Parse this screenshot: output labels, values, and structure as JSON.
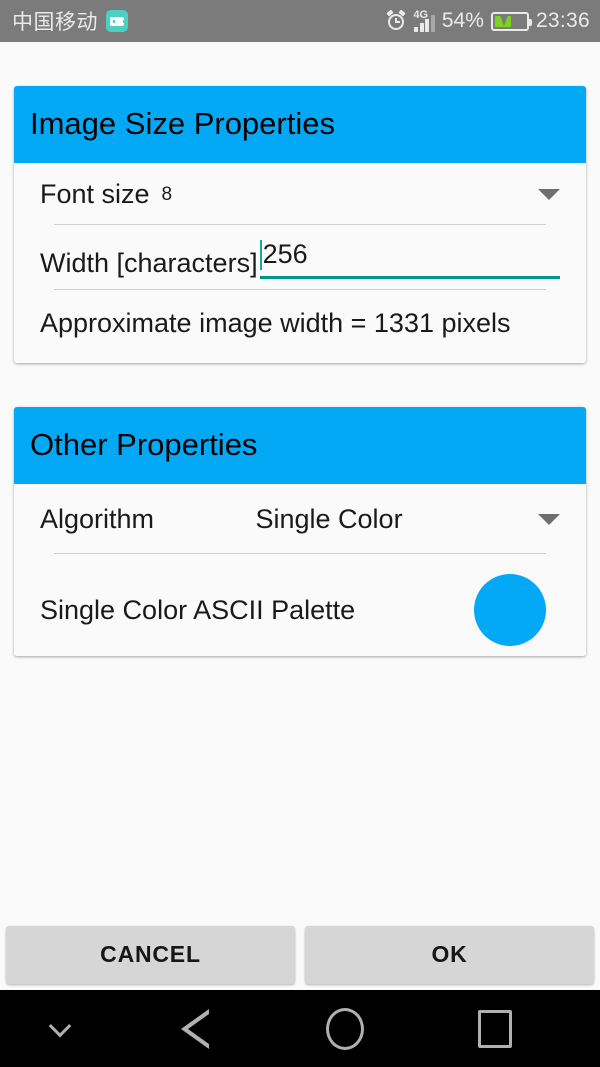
{
  "statusbar": {
    "carrier": "中国移动",
    "carrier_badge_icon": "android-face-icon",
    "alarm_icon": "alarm-clock-icon",
    "network_type": "4G",
    "signal_icon": "signal-bars-icon",
    "battery_percent": "54%",
    "battery_icon": "battery-charging-icon",
    "clock": "23:36",
    "background_color": "#7b7b7b",
    "text_color": "#eaeaea"
  },
  "dialog": {
    "accent_color": "#03A9F4",
    "focus_color": "#009688",
    "sections": [
      {
        "title": "Image Size Properties",
        "rows": [
          {
            "type": "spinner",
            "label": "Font size",
            "value": "8",
            "arrow_icon": "chevron-down-icon"
          },
          {
            "type": "edittext",
            "label": "Width [characters]",
            "value": "256",
            "focused": true
          },
          {
            "type": "static",
            "text": "Approximate image width = 1331 pixels"
          }
        ]
      },
      {
        "title": "Other Properties",
        "rows": [
          {
            "type": "spinner-right",
            "label": "Algorithm",
            "value": "Single Color",
            "arrow_icon": "chevron-down-icon"
          },
          {
            "type": "palette",
            "label": "Single Color ASCII Palette",
            "swatch_color": "#03A9F4"
          }
        ]
      }
    ]
  },
  "buttons": {
    "cancel_label": "CANCEL",
    "ok_label": "OK"
  },
  "navbar": {
    "hide_icon": "chevron-down-icon",
    "back_icon": "back-triangle-icon",
    "home_icon": "home-circle-icon",
    "recents_icon": "recents-square-icon"
  }
}
